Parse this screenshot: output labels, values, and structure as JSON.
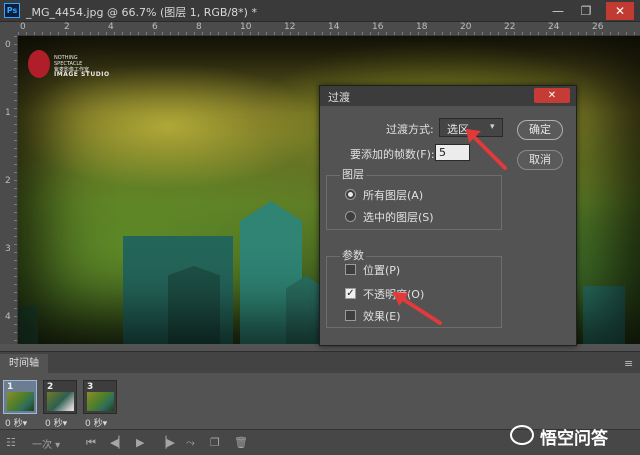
{
  "window": {
    "app_badge": "Ps",
    "doc_title": "_MG_4454.jpg @ 66.7% (图层 1, RGB/8*) *",
    "min_glyph": "—",
    "max_glyph": "❐",
    "close_glyph": "✕"
  },
  "rulers": {
    "top": [
      "0",
      "2",
      "4",
      "6",
      "8",
      "10",
      "12",
      "14",
      "16",
      "18",
      "20",
      "22",
      "24",
      "26"
    ],
    "left": [
      "0",
      "1",
      "2",
      "3",
      "4"
    ]
  },
  "watermark": {
    "line1": "NOTHING",
    "line2": "SPECTACLE",
    "line3": "紫麦影像工作室",
    "studio": "IMAGE STUDIO"
  },
  "dialog": {
    "title": "过渡",
    "close_glyph": "✕",
    "transition_method_label": "过渡方式:",
    "transition_method_value": "选区",
    "frames_to_add_label": "要添加的帧数(F):",
    "frames_to_add_value": "5",
    "ok_label": "确定",
    "cancel_label": "取消",
    "layers_group": {
      "title": "图层",
      "options": [
        {
          "label": "所有图层(A)",
          "selected": true
        },
        {
          "label": "选中的图层(S)",
          "selected": false
        }
      ]
    },
    "params_group": {
      "title": "参数",
      "options": [
        {
          "label": "位置(P)",
          "checked": false
        },
        {
          "label": "不透明度(O)",
          "checked": true
        },
        {
          "label": "效果(E)",
          "checked": false
        }
      ]
    }
  },
  "timeline": {
    "tab_label": "时间轴",
    "menu_glyph": "≡",
    "frames": [
      {
        "num": "1",
        "time": "0 秒▾",
        "selected": true
      },
      {
        "num": "2",
        "time": "0 秒▾",
        "selected": false
      },
      {
        "num": "3",
        "time": "0 秒▾",
        "selected": false
      }
    ],
    "loop_label": "一次",
    "toolbar_icons": [
      "convert-icon",
      "first-frame-icon",
      "prev-frame-icon",
      "play-icon",
      "next-frame-icon",
      "tween-icon",
      "duplicate-icon",
      "delete-icon"
    ]
  },
  "brand": {
    "text": "悟空问答"
  },
  "colors": {
    "panel_bg": "#535353",
    "titlebar_bg": "#3a3a3a",
    "close_red": "#c23b32",
    "annotation_arrow": "#e03a3a",
    "ps_blue": "#31a8ff"
  }
}
